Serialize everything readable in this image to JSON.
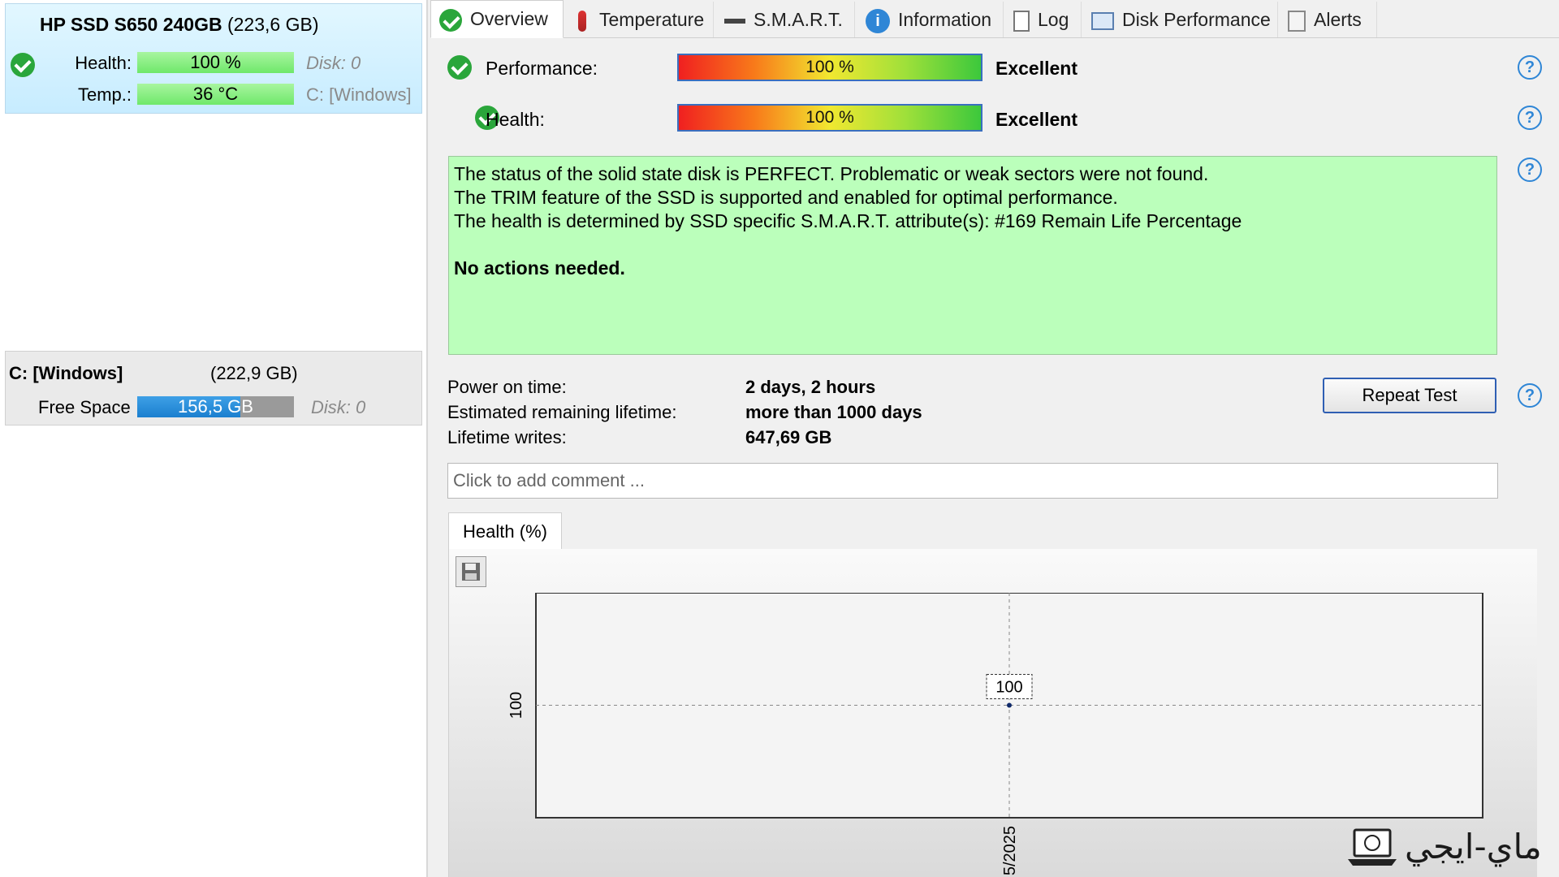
{
  "left": {
    "disk": {
      "name": "HP SSD S650 240GB",
      "size": "(223,6 GB)",
      "health_label": "Health:",
      "health_value": "100 %",
      "health_fraction": 1.0,
      "disk_label": "Disk: 0",
      "temp_label": "Temp.:",
      "temp_value": "36 °C",
      "volume_ref": "C: [Windows]"
    },
    "volume": {
      "name": "C: [Windows]",
      "size": "(222,9 GB)",
      "free_label": "Free Space",
      "free_value": "156,5 GB",
      "disk_label": "Disk: 0"
    }
  },
  "tabs": [
    {
      "label": "Overview",
      "icon": "check-icon"
    },
    {
      "label": "Temperature",
      "icon": "thermometer-icon"
    },
    {
      "label": "S.M.A.R.T.",
      "icon": "smart-icon"
    },
    {
      "label": "Information",
      "icon": "info-icon"
    },
    {
      "label": "Log",
      "icon": "document-icon"
    },
    {
      "label": "Disk Performance",
      "icon": "performance-chart-icon"
    },
    {
      "label": "Alerts",
      "icon": "alerts-icon"
    }
  ],
  "overview": {
    "performance": {
      "label": "Performance:",
      "value": "100 %",
      "rating": "Excellent"
    },
    "health": {
      "label": "Health:",
      "value": "100 %",
      "rating": "Excellent"
    },
    "status_lines": [
      "The status of the solid state disk is PERFECT. Problematic or weak sectors were not found.",
      "The TRIM feature of the SSD is supported and enabled for optimal performance.",
      "The health is determined by SSD specific S.M.A.R.T. attribute(s):  #169 Remain Life Percentage"
    ],
    "status_action": "No actions needed.",
    "power_on_label": "Power on time:",
    "power_on_value": "2 days, 2 hours",
    "remaining_label": "Estimated remaining lifetime:",
    "remaining_value": "more than 1000 days",
    "writes_label": "Lifetime writes:",
    "writes_value": "647,69 GB",
    "repeat_button": "Repeat Test",
    "comment_placeholder": "Click to add comment ..."
  },
  "chart_tab": "Health (%)",
  "chart_data": {
    "type": "line",
    "series": [
      {
        "values": [
          100
        ]
      }
    ],
    "x": [
      "5/2025"
    ],
    "y_tick_labels": [
      "100"
    ],
    "x_tick_labels": [
      "5/2025"
    ],
    "data_labels": [
      "100"
    ],
    "grid": true
  },
  "watermark": "ماي-ايجي",
  "colors": {
    "status_bg": "#bbffbb",
    "ok_green": "#2aa63b",
    "accent_blue": "#2f86d6"
  }
}
